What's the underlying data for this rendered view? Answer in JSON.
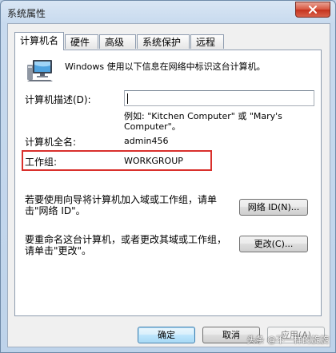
{
  "window": {
    "title": "系统属性"
  },
  "tabs": [
    {
      "label": "计算机名"
    },
    {
      "label": "硬件"
    },
    {
      "label": "高级"
    },
    {
      "label": "系统保护"
    },
    {
      "label": "远程"
    }
  ],
  "panel": {
    "intro": "Windows 使用以下信息在网络中标识这台计算机。",
    "description": {
      "label": "计算机描述(D):",
      "value": "",
      "example_line1": "例如: \"Kitchen Computer\" 或 \"Mary's",
      "example_line2": "Computer\"。"
    },
    "full_name": {
      "label": "计算机全名:",
      "value": "admin456"
    },
    "workgroup": {
      "label": "工作组:",
      "value": "WORKGROUP"
    },
    "network_id": {
      "text_line1": "若要使用向导将计算机加入域或工作组，请单",
      "text_line2": "击\"网络 ID\"。",
      "button": "网络 ID(N)..."
    },
    "rename": {
      "text_line1": "要重命名这台计算机，或者更改其域或工作组，",
      "text_line2": "请单击\"更改\"。",
      "button": "更改(C)..."
    }
  },
  "footer": {
    "ok": "确定",
    "cancel": "取消",
    "apply": "应用(A)"
  },
  "watermark": "头条 @不一样的旋旋",
  "colors": {
    "highlight_box": "#d9302c",
    "title_bar": "#c8daee",
    "close_button": "#c4321d"
  }
}
